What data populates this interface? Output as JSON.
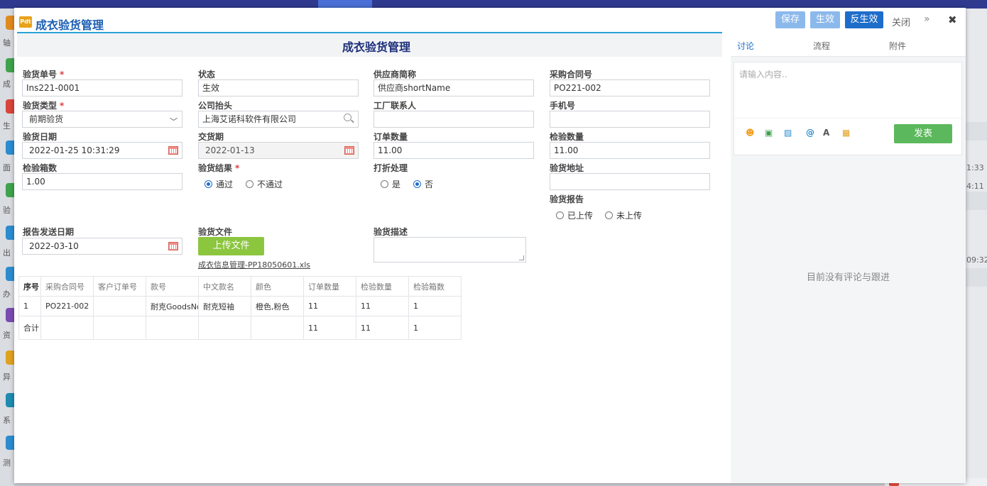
{
  "modal": {
    "title": "成衣验货管理",
    "buttons": {
      "save": "保存",
      "effective": "生效",
      "reverse_effective": "反生效",
      "close": "关闭",
      "more": "»",
      "x": "✖"
    }
  },
  "form": {
    "title": "成衣验货管理",
    "fields": {
      "inspection_no": {
        "label": "验货单号",
        "value": "Ins221-0001"
      },
      "status": {
        "label": "状态",
        "value": "生效"
      },
      "supplier_short": {
        "label": "供应商简称",
        "value": "供应商shortName"
      },
      "purchase_contract_no": {
        "label": "采购合同号",
        "value": "PO221-002"
      },
      "inspection_type": {
        "label": "验货类型",
        "value": "前期验货"
      },
      "company_header": {
        "label": "公司抬头",
        "value": "上海艾诺科软件有限公司"
      },
      "factory_contact": {
        "label": "工厂联系人",
        "value": ""
      },
      "mobile": {
        "label": "手机号",
        "value": ""
      },
      "inspection_date": {
        "label": "验货日期",
        "value": "2022-01-25 10:31:29"
      },
      "delivery_date": {
        "label": "交货期",
        "value": "2022-01-13"
      },
      "order_qty": {
        "label": "订单数量",
        "value": "11.00"
      },
      "inspect_qty": {
        "label": "检验数量",
        "value": "11.00"
      },
      "inspect_boxes": {
        "label": "检验箱数",
        "value": "1.00"
      },
      "inspection_result": {
        "label": "验货结果",
        "options": [
          "通过",
          "不通过"
        ],
        "selected": "通过"
      },
      "discount": {
        "label": "打折处理",
        "options": [
          "是",
          "否"
        ],
        "selected": "否"
      },
      "inspection_address": {
        "label": "验货地址",
        "value": ""
      },
      "inspection_report": {
        "label": "验货报告",
        "options": [
          "已上传",
          "未上传"
        ],
        "selected": ""
      },
      "report_send_date": {
        "label": "报告发送日期",
        "value": "2022-03-10"
      },
      "inspection_file": {
        "label": "验货文件",
        "upload_label": "上传文件",
        "file_name": "成衣信息管理-PP18050601.xls"
      },
      "inspection_desc": {
        "label": "验货描述",
        "value": ""
      }
    },
    "required_mark": "*"
  },
  "table": {
    "headers": [
      "序号",
      "采购合同号",
      "客户订单号",
      "款号",
      "中文款名",
      "颜色",
      "订单数量",
      "检验数量",
      "检验箱数"
    ],
    "rows": [
      [
        "1",
        "PO221-002",
        "",
        "耐克GoodsNo",
        "耐克短袖",
        "橙色,粉色",
        "11",
        "11",
        "1"
      ]
    ],
    "total": [
      "合计",
      "",
      "",
      "",
      "",
      "",
      "11",
      "11",
      "1"
    ]
  },
  "side_panel": {
    "tabs": [
      "讨论",
      "流程",
      "附件"
    ],
    "active_tab": "讨论",
    "comment_placeholder": "请输入内容..",
    "tools": [
      "emoji-icon",
      "image-icon",
      "attachment-icon",
      "at-icon",
      "font-icon",
      "grid-icon"
    ],
    "tool_glyphs": [
      "☻",
      "▣",
      "▨",
      "@",
      "A",
      "▦"
    ],
    "send_label": "发表",
    "empty_text": "目前没有评论与跟进"
  },
  "background": {
    "right_times": [
      "1:33",
      "4:11",
      "09:32"
    ],
    "left_labels": [
      "轴",
      "成",
      "生",
      "面",
      "验",
      "出",
      "办",
      "资",
      "异",
      "系",
      "测"
    ]
  }
}
